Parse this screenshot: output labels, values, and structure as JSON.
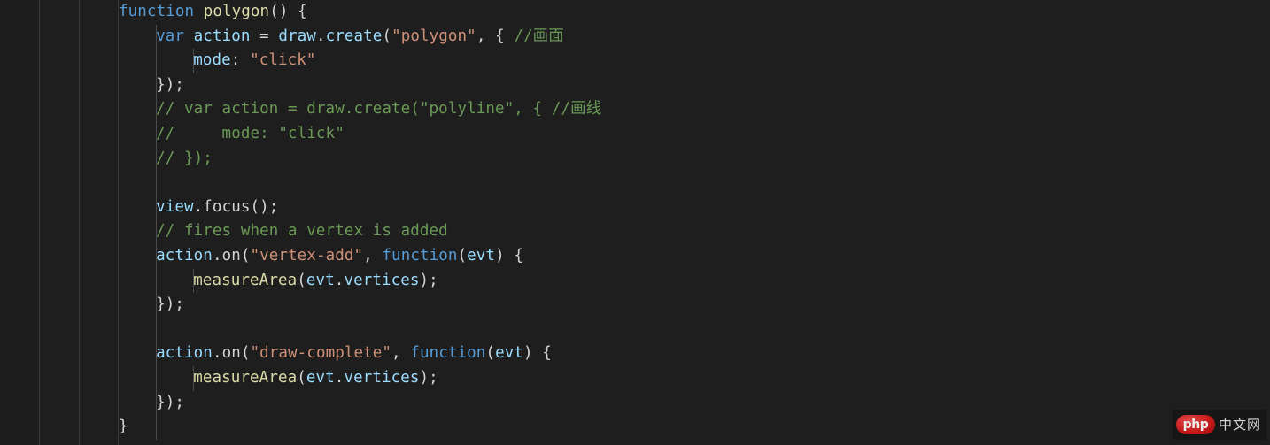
{
  "editor": {
    "language": "javascript",
    "background_color": "#1e1e1e",
    "foreground_color": "#d4d4d4",
    "gutter_color": "#1d1d1d",
    "indent_guide_color": "#4a4a4a",
    "divider_color": "#3a3a3a",
    "font_size_px": 17.5,
    "line_height_px": 27.6,
    "tab_size": 4,
    "palette": {
      "keyword": "#569cd6",
      "function_name": "#dcdcaa",
      "variable": "#9cdcfe",
      "string": "#ce9178",
      "comment": "#6a9955",
      "punctuation": "#d4d4d4"
    },
    "plain_text": "function polygon() {\n    var action = draw.create(\"polygon\", { //画面\n        mode: \"click\"\n    });\n    // var action = draw.create(\"polyline\", { //画线\n    //     mode: \"click\"\n    // });\n\n    view.focus();\n    // fires when a vertex is added\n    action.on(\"vertex-add\", function(evt) {\n        measureArea(evt.vertices);\n    });\n\n    action.on(\"draw-complete\", function(evt) {\n        measureArea(evt.vertices);\n    });\n}",
    "lines": [
      {
        "indent": 0,
        "tokens": [
          {
            "t": "function",
            "c": "t-keyword"
          },
          {
            "t": " ",
            "c": "t-plain"
          },
          {
            "t": "polygon",
            "c": "t-func"
          },
          {
            "t": "() {",
            "c": "t-punct"
          }
        ]
      },
      {
        "indent": 1,
        "tokens": [
          {
            "t": "var",
            "c": "t-storage"
          },
          {
            "t": " ",
            "c": "t-plain"
          },
          {
            "t": "action",
            "c": "t-var"
          },
          {
            "t": " = ",
            "c": "t-operator"
          },
          {
            "t": "draw",
            "c": "t-var"
          },
          {
            "t": ".",
            "c": "t-punct"
          },
          {
            "t": "create",
            "c": "t-var"
          },
          {
            "t": "(",
            "c": "t-paren"
          },
          {
            "t": "\"polygon\"",
            "c": "t-string"
          },
          {
            "t": ", { ",
            "c": "t-punct"
          },
          {
            "t": "//画面",
            "c": "t-comment"
          }
        ]
      },
      {
        "indent": 2,
        "tokens": [
          {
            "t": "mode",
            "c": "t-prop"
          },
          {
            "t": ": ",
            "c": "t-punct"
          },
          {
            "t": "\"click\"",
            "c": "t-string"
          }
        ]
      },
      {
        "indent": 1,
        "tokens": [
          {
            "t": "});",
            "c": "t-punct"
          }
        ]
      },
      {
        "indent": 1,
        "tokens": [
          {
            "t": "// var action = draw.create(\"polyline\", { //画线",
            "c": "t-comment"
          }
        ]
      },
      {
        "indent": 1,
        "tokens": [
          {
            "t": "//     mode: \"click\"",
            "c": "t-comment"
          }
        ]
      },
      {
        "indent": 1,
        "tokens": [
          {
            "t": "// });",
            "c": "t-comment"
          }
        ]
      },
      {
        "indent": 0,
        "tokens": []
      },
      {
        "indent": 1,
        "tokens": [
          {
            "t": "view",
            "c": "t-var"
          },
          {
            "t": ".",
            "c": "t-punct"
          },
          {
            "t": "focus",
            "c": "t-method"
          },
          {
            "t": "();",
            "c": "t-punct"
          }
        ]
      },
      {
        "indent": 1,
        "tokens": [
          {
            "t": "// fires when a vertex is added",
            "c": "t-comment"
          }
        ]
      },
      {
        "indent": 1,
        "tokens": [
          {
            "t": "action",
            "c": "t-var"
          },
          {
            "t": ".",
            "c": "t-punct"
          },
          {
            "t": "on",
            "c": "t-method"
          },
          {
            "t": "(",
            "c": "t-paren"
          },
          {
            "t": "\"vertex-add\"",
            "c": "t-string"
          },
          {
            "t": ", ",
            "c": "t-punct"
          },
          {
            "t": "function",
            "c": "t-keyword"
          },
          {
            "t": "(",
            "c": "t-paren"
          },
          {
            "t": "evt",
            "c": "t-var"
          },
          {
            "t": ") {",
            "c": "t-punct"
          }
        ]
      },
      {
        "indent": 2,
        "tokens": [
          {
            "t": "measureArea",
            "c": "t-func"
          },
          {
            "t": "(",
            "c": "t-paren"
          },
          {
            "t": "evt",
            "c": "t-var"
          },
          {
            "t": ".",
            "c": "t-punct"
          },
          {
            "t": "vertices",
            "c": "t-var"
          },
          {
            "t": ");",
            "c": "t-punct"
          }
        ]
      },
      {
        "indent": 1,
        "tokens": [
          {
            "t": "});",
            "c": "t-punct"
          }
        ]
      },
      {
        "indent": 0,
        "tokens": []
      },
      {
        "indent": 1,
        "tokens": [
          {
            "t": "action",
            "c": "t-var"
          },
          {
            "t": ".",
            "c": "t-punct"
          },
          {
            "t": "on",
            "c": "t-method"
          },
          {
            "t": "(",
            "c": "t-paren"
          },
          {
            "t": "\"draw-complete\"",
            "c": "t-string"
          },
          {
            "t": ", ",
            "c": "t-punct"
          },
          {
            "t": "function",
            "c": "t-keyword"
          },
          {
            "t": "(",
            "c": "t-paren"
          },
          {
            "t": "evt",
            "c": "t-var"
          },
          {
            "t": ") {",
            "c": "t-punct"
          }
        ]
      },
      {
        "indent": 2,
        "tokens": [
          {
            "t": "measureArea",
            "c": "t-func"
          },
          {
            "t": "(",
            "c": "t-paren"
          },
          {
            "t": "evt",
            "c": "t-var"
          },
          {
            "t": ".",
            "c": "t-punct"
          },
          {
            "t": "vertices",
            "c": "t-var"
          },
          {
            "t": ");",
            "c": "t-punct"
          }
        ]
      },
      {
        "indent": 1,
        "tokens": [
          {
            "t": "});",
            "c": "t-punct"
          }
        ]
      },
      {
        "indent": 0,
        "tokens": [
          {
            "t": "}",
            "c": "t-punct"
          }
        ]
      }
    ],
    "indent_guides": [
      {
        "level": 1,
        "from_line": 1,
        "to_line": 17
      },
      {
        "level": 2,
        "from_line": 2,
        "to_line": 2
      },
      {
        "level": 2,
        "from_line": 11,
        "to_line": 11
      },
      {
        "level": 2,
        "from_line": 15,
        "to_line": 15
      }
    ]
  },
  "watermark": {
    "badge_label": "php",
    "text": "中文网",
    "badge_color": "#d61a1a",
    "text_color": "#e8e8e8"
  }
}
